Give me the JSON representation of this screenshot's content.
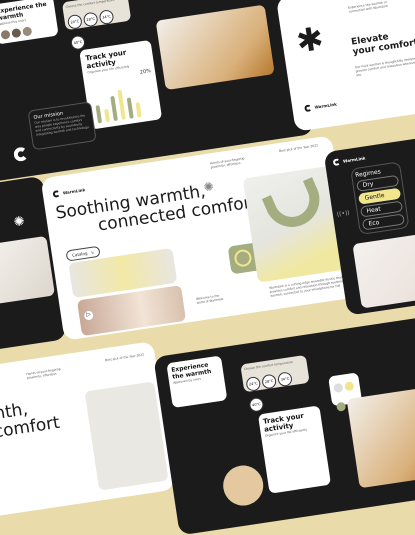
{
  "brand": "WarmLink",
  "colors": {
    "background": "#e9dcaa",
    "dark": "#1c1b1b",
    "olive": "#a3ad7f",
    "yellow": "#f1e58e"
  },
  "hero": {
    "title_line1": "Soothing warmth,",
    "title_line2": "connected comfort",
    "catalog_label": "Catalog",
    "award": "Best pick of the Year 2022",
    "tagline": "Hands-of-your-fingertip proximity, effortless",
    "welcome": "Welcome to the world of Warmlink",
    "description": "WarmLink is a cutting-edge wearable device that provides comfort and relaxation through soothing warmth, connected to your smartphone for full control."
  },
  "track": {
    "title": "Track your activity",
    "subtitle": "Organize your life efficiently",
    "percent": "20%",
    "ticks": [
      "20k",
      "15k",
      "10k",
      "5k"
    ],
    "bars": [
      0.6,
      0.45,
      0.85,
      1.0,
      0.7,
      0.5
    ]
  },
  "experience": {
    "title": "Experience the warmth",
    "approved": "Approved by users"
  },
  "temperature": {
    "label": "Choose the comfort temperature",
    "options": [
      "24°C",
      "28°C",
      "34°C",
      "40°C"
    ]
  },
  "mission": {
    "title": "Our mission",
    "text": "Our mission is to revolutionize the way people experience comfort and connectivity by seamlessly integrating warmth and technology."
  },
  "elevate": {
    "title_line1": "Elevate",
    "title_line2": "your comfort",
    "intro": "Experience the warmth of connection with WarmLink",
    "body": "Our neck warmer is thoughtfully designed to provide comfort and relaxation wherever you are."
  },
  "regimes": {
    "title": "Regimes",
    "options": [
      "Dry",
      "Gentle",
      "Heat",
      "Eco"
    ]
  }
}
